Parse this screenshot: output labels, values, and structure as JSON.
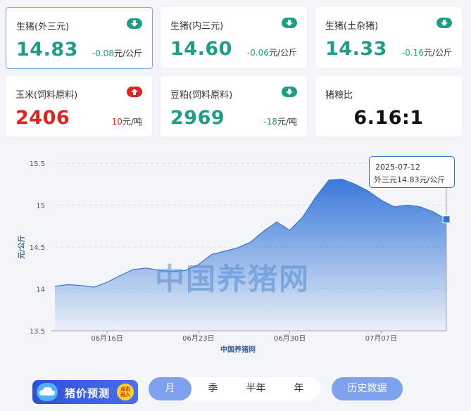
{
  "cards": [
    {
      "label": "生猪(外三元)",
      "value": "14.83",
      "change": "-0.08",
      "unit": "元/公斤",
      "trend": "down",
      "color": "#1f9e86"
    },
    {
      "label": "生猪(内三元)",
      "value": "14.60",
      "change": "-0.06",
      "unit": "元/公斤",
      "trend": "down",
      "color": "#1f9e86"
    },
    {
      "label": "生猪(土杂猪)",
      "value": "14.33",
      "change": "-0.16",
      "unit": "元/公斤",
      "trend": "down",
      "color": "#1f9e86"
    },
    {
      "label": "玉米(饲料原料)",
      "value": "2406",
      "change": "10",
      "unit": "元/吨",
      "trend": "up",
      "color": "#e0231d"
    },
    {
      "label": "豆粕(饲料原料)",
      "value": "2969",
      "change": "-18",
      "unit": "元/吨",
      "trend": "down",
      "color": "#1f9e86"
    },
    {
      "label": "猪粮比",
      "value": "6.16:1"
    }
  ],
  "chart_data": {
    "type": "area",
    "ylabel": "元/公斤",
    "xlabel": "中国养猪网",
    "ylim": [
      13.5,
      15.5
    ],
    "yticks": [
      "13.5",
      "14",
      "14.5",
      "15",
      "15.5"
    ],
    "xticks": [
      {
        "pos": 4,
        "label": "06月16日"
      },
      {
        "pos": 11,
        "label": "06月23日"
      },
      {
        "pos": 18,
        "label": "06月30日"
      },
      {
        "pos": 25,
        "label": "07月07日"
      }
    ],
    "x": [
      "06-12",
      "06-13",
      "06-14",
      "06-15",
      "06-16",
      "06-17",
      "06-18",
      "06-19",
      "06-20",
      "06-21",
      "06-22",
      "06-23",
      "06-24",
      "06-25",
      "06-26",
      "06-27",
      "06-28",
      "06-29",
      "06-30",
      "07-01",
      "07-02",
      "07-03",
      "07-04",
      "07-05",
      "07-06",
      "07-07",
      "07-08",
      "07-09",
      "07-10",
      "07-11",
      "07-12"
    ],
    "values": [
      14.03,
      14.05,
      14.04,
      14.02,
      14.08,
      14.16,
      14.23,
      14.25,
      14.22,
      14.21,
      14.22,
      14.29,
      14.41,
      14.45,
      14.49,
      14.56,
      14.69,
      14.8,
      14.7,
      14.86,
      15.1,
      15.3,
      15.31,
      15.25,
      15.17,
      15.06,
      14.98,
      15.0,
      14.98,
      14.92,
      14.83
    ],
    "grid": "horizontal dashed",
    "color": "#3c7bd6"
  },
  "tooltip": {
    "date": "2025-07-12",
    "text": "外三元14.83元/公斤"
  },
  "watermark": "中国养猪网",
  "predict": {
    "label": "猪价预测",
    "badge1": "点击",
    "badge2": "进入"
  },
  "tabs": [
    "月",
    "季",
    "半年",
    "年"
  ],
  "active_tab": "月",
  "history_button": "历史数据"
}
